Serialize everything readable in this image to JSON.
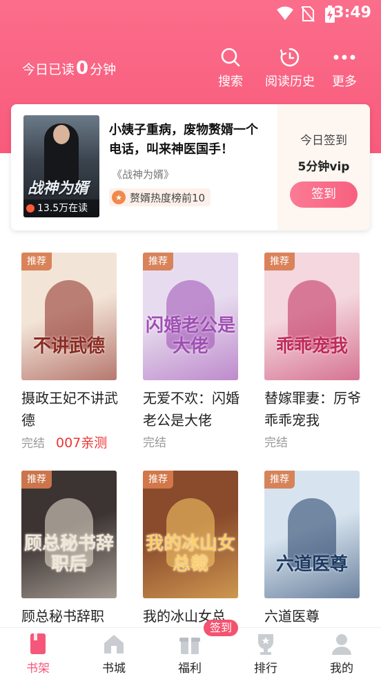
{
  "status_bar": {
    "time": "3:49"
  },
  "header": {
    "today_read_prefix": "今日已读",
    "today_read_minutes": "0",
    "today_read_suffix": "分钟",
    "actions": [
      {
        "label": "搜索",
        "icon": "search-icon"
      },
      {
        "label": "阅读历史",
        "icon": "history-icon"
      },
      {
        "label": "更多",
        "icon": "more-icon"
      }
    ]
  },
  "featured": {
    "cover_title": "战神为婿",
    "readers": "13.5万在读",
    "title": "小姨子重病，废物赘婿一个电话，叫来神医国手！",
    "book_name": "《战神为婿》",
    "rank": "赘婿热度榜前10",
    "sign_label": "今日签到",
    "sign_reward": "5分钟vip",
    "sign_button": "签到"
  },
  "books": [
    {
      "tag": "推荐",
      "cover_text": "不讲武德",
      "title": "摄政王妃不讲武德",
      "status": "完结",
      "promo": "007亲测",
      "colors": [
        "#f3e4d8",
        "#8a2a22"
      ]
    },
    {
      "tag": "推荐",
      "cover_text": "闪婚老公是大佬",
      "title": "无爱不欢：闪婚老公是大佬",
      "status": "完结",
      "promo": "",
      "colors": [
        "#e7dcef",
        "#9f4fb3"
      ]
    },
    {
      "tag": "推荐",
      "cover_text": "乖乖宠我",
      "title": "替嫁罪妻：厉爷乖乖宠我",
      "status": "完结",
      "promo": "",
      "colors": [
        "#f4d7df",
        "#c02a5b"
      ]
    },
    {
      "tag": "推荐",
      "cover_text": "顾总秘书辞职后",
      "title": "顾总秘书辞职",
      "status": "",
      "promo": "",
      "colors": [
        "#3b3433",
        "#f1e7d6"
      ]
    },
    {
      "tag": "推荐",
      "cover_text": "我的冰山女总裁",
      "title": "我的冰山女总",
      "status": "",
      "promo": "",
      "colors": [
        "#8a4a2c",
        "#ffcf6a"
      ]
    },
    {
      "tag": "推荐",
      "cover_text": "六道医尊",
      "title": "六道医尊",
      "status": "",
      "promo": "",
      "colors": [
        "#d7e4ef",
        "#1d3a63"
      ]
    }
  ],
  "tabbar": {
    "items": [
      {
        "label": "书架",
        "icon": "bookshelf-icon",
        "active": true
      },
      {
        "label": "书城",
        "icon": "bookstore-icon",
        "active": false
      },
      {
        "label": "福利",
        "icon": "gift-icon",
        "active": false
      },
      {
        "label": "排行",
        "icon": "ranking-icon",
        "active": false
      },
      {
        "label": "我的",
        "icon": "profile-icon",
        "active": false
      }
    ],
    "badge": "签到"
  },
  "theme": {
    "accent": "#f95a7c",
    "tag_color": "#d77b4d"
  }
}
